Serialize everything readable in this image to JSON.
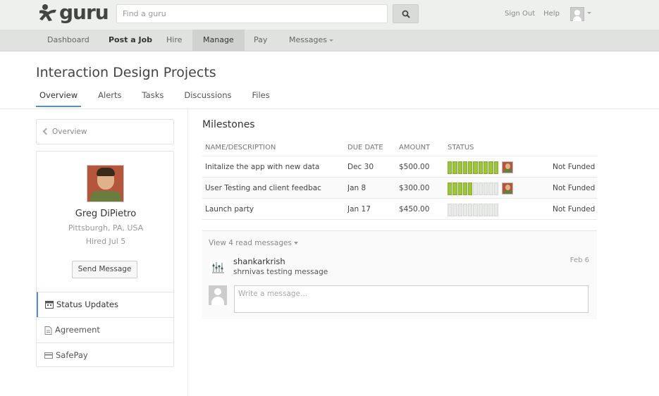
{
  "header": {
    "logo_text": "guru",
    "search_placeholder": "Find a guru",
    "links": [
      "Sign Out",
      "Help"
    ]
  },
  "nav": {
    "items": [
      {
        "label": "Dashboard"
      },
      {
        "label": "Post a Job"
      },
      {
        "label": "Hire"
      },
      {
        "label": "Manage"
      },
      {
        "label": "Pay"
      },
      {
        "label": "Messages"
      }
    ],
    "active": "Manage"
  },
  "page": {
    "title": "Interaction Design Projects",
    "tabs": [
      "Overview",
      "Alerts",
      "Tasks",
      "Discussions",
      "Files"
    ],
    "active_tab": "Overview"
  },
  "sidebar": {
    "back_label": "Overview",
    "profile": {
      "name": "Greg DiPietro",
      "location": "Pittsburgh, PA, USA",
      "hired": "Hired Jul 5",
      "send_message_label": "Send Message"
    },
    "items": [
      {
        "label": "Status Updates",
        "icon": "calendar-icon"
      },
      {
        "label": "Agreement",
        "icon": "document-icon"
      },
      {
        "label": "SafePay",
        "icon": "card-icon"
      }
    ]
  },
  "milestones": {
    "title": "Milestones",
    "columns": [
      "NAME/DESCRIPTION",
      "DUE DATE",
      "AMOUNT",
      "STATUS"
    ],
    "rows": [
      {
        "name": "Initalize the app with new data",
        "due": "Dec 30",
        "amount": "$500.00",
        "progress_segments": 10,
        "status": "Not Funded"
      },
      {
        "name": "User Testing and client feedbac",
        "due": "Jan 8",
        "amount": "$300.00",
        "progress_segments": 5,
        "status": "Not Funded"
      },
      {
        "name": "Launch party",
        "due": "Jan 17",
        "amount": "$450.00",
        "progress_segments": 0,
        "status": "Not Funded"
      }
    ],
    "total_segments": 10,
    "accent_color": "#9dc53c"
  },
  "messages": {
    "view_read_label": "View 4 read messages",
    "items": [
      {
        "sender": "shankarkrish",
        "text": "shrnivas testing message",
        "date": "Feb 6"
      }
    ],
    "input_placeholder": "Write a message..."
  }
}
